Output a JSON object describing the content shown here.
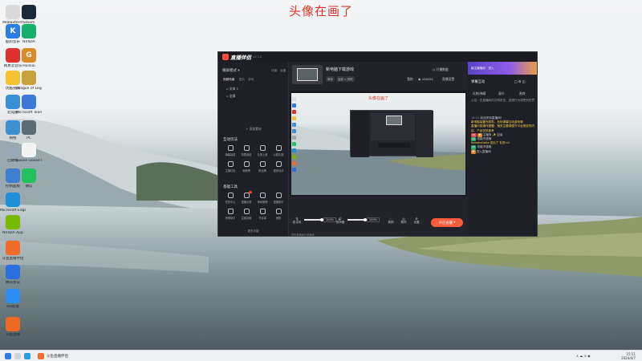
{
  "overlay_title": "头像在画了",
  "desktop": {
    "icons": [
      {
        "label": "Mobaxterm",
        "color": "#d9d9d9",
        "glyph": ""
      },
      {
        "label": "Steam",
        "color": "#1b2838",
        "glyph": ""
      },
      {
        "label": "酷狗音乐",
        "color": "#2a7de1",
        "glyph": "K"
      },
      {
        "label": "NVIDIA",
        "color": "#17b06b",
        "glyph": ""
      },
      {
        "label": "网易云音乐",
        "color": "#e0302e",
        "glyph": ""
      },
      {
        "label": "Honkai",
        "color": "#d98a2b",
        "glyph": "G"
      },
      {
        "label": "优酷视频",
        "color": "#f2c230",
        "glyph": ""
      },
      {
        "label": "League of Legends",
        "color": "#c8a03c",
        "glyph": ""
      },
      {
        "label": "此电脑",
        "color": "#3b8fd6",
        "glyph": ""
      },
      {
        "label": "Microsoft Teams",
        "color": "#3b78d8",
        "glyph": ""
      },
      {
        "label": "网络",
        "color": "#3e8ed0",
        "glyph": ""
      },
      {
        "label": "PC",
        "color": "#5b6b74",
        "glyph": ""
      },
      {
        "label": "回收站",
        "color": "#9aa8b4",
        "glyph": ""
      },
      {
        "label": "Goose Goose Duck",
        "color": "#f4f4f4",
        "glyph": ""
      },
      {
        "label": "控制面板",
        "color": "#3f7fd1",
        "glyph": ""
      },
      {
        "label": "微信",
        "color": "#22c15e",
        "glyph": ""
      },
      {
        "label": "Microsoft Edge",
        "color": "#1c8fd8",
        "glyph": ""
      },
      {
        "label": "NVIDIA App",
        "color": "#76b900",
        "glyph": ""
      },
      {
        "label": "斗鱼直播伴侣",
        "color": "#f36b2b",
        "glyph": ""
      },
      {
        "label": "腾讯会议",
        "color": "#2a6fe0",
        "glyph": ""
      },
      {
        "label": "UU加速",
        "color": "#2f8df5",
        "glyph": ""
      },
      {
        "label": "斗鱼直播",
        "color": "#ee6a22",
        "glyph": ""
      }
    ]
  },
  "app": {
    "logo": "直播伴侣",
    "version": "v3.3.4",
    "left": {
      "mode": "横屏模式",
      "scene_label": "场景",
      "settings": "设置",
      "tabs": [
        "视频场景",
        "图片",
        "游戏"
      ],
      "scenes": [
        "文本 1",
        "全屏"
      ],
      "add_scene": "+ 添加素材",
      "interact_title": "互动玩法",
      "interact_tools": [
        "弹幕抽奖",
        "投票竞猜",
        "礼物上墙",
        "心愿礼物",
        "主播红包",
        "贡献榜",
        "粉丝牌",
        "更多玩法"
      ],
      "basic_title": "基础工具",
      "basic_tools": [
        "任务中心",
        "直播记录",
        "房间管理",
        "直播助手",
        "房管助手",
        "主题设置",
        "节目单",
        "美颜"
      ],
      "more": "更多功能"
    },
    "center": {
      "stream_title": "新电脑下载游戏",
      "tags": [
        "单机",
        "全部 > 其他"
      ],
      "header_right": [
        "开播数据",
        "我的",
        "直播设置"
      ],
      "online": "428451",
      "preview_title": "头像在画了",
      "controls": {
        "mic_label": "麦克风",
        "mic_value": "100%",
        "speaker_label": "扬声器",
        "speaker_value": "100%",
        "buttons": [
          "美颜",
          "素材",
          "设置"
        ],
        "go_live": "开启直播"
      },
      "status_bar": "您的直播间正常播放"
    },
    "right": {
      "banner": "新主播福利 · 进入",
      "title": "弹幕互动",
      "tabs": [
        "礼物/弹幕",
        "观众",
        "贵宾"
      ],
      "notice": "公告：在直播间内文明发言，违规行为将受到处罚",
      "chat": [
        {
          "time": "14:12",
          "text": "欢迎来到直播间！"
        },
        {
          "time": "",
          "text": "新电脑装置完成啦，在玩弹幕互动游戏哦"
        },
        {
          "time": "",
          "text": "直播问答操作提醒：相关主题请遵守平台规定的内容，产品仅供参考"
        },
        {
          "time": "",
          "text": "主播帅 ✨ 加油"
        },
        {
          "time": "",
          "text": "电脑不错哦"
        },
        {
          "time": "",
          "text": "bobahahaha 送出了 礼物 x1"
        },
        {
          "time": "",
          "text": "电脑不错哦"
        },
        {
          "time": "",
          "text": "进入直播间"
        }
      ]
    }
  },
  "taskbar": {
    "app_label": "斗鱼直播伴侣",
    "time": "15:51",
    "date": "2024/4/7"
  }
}
